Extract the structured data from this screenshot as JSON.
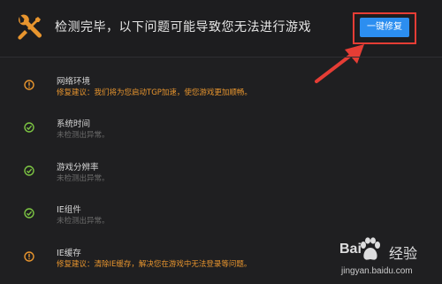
{
  "header": {
    "title": "检测完毕，以下问题可能导致您无法进行游戏",
    "fix_button_label": "一键修复"
  },
  "items": [
    {
      "name": "网络环境",
      "detail": "修复建议：我们将为您启动TGP加速，使您游戏更加顺畅。",
      "status": "warning"
    },
    {
      "name": "系统时间",
      "detail": "未检测出异常。",
      "status": "ok"
    },
    {
      "name": "游戏分辨率",
      "detail": "未检测出异常。",
      "status": "ok"
    },
    {
      "name": "IE组件",
      "detail": "未检测出异常。",
      "status": "ok"
    },
    {
      "name": "IE缓存",
      "detail": "修复建议：清除IE缓存，解决您在游戏中无法登录等问题。",
      "status": "warning"
    }
  ],
  "watermark": {
    "brand_text_1": "Bai",
    "brand_text_2": "经验",
    "url": "jingyan.baidu.com"
  },
  "colors": {
    "background": "#1f1f21",
    "accent_blue": "#2c8ef0",
    "warning_orange": "#e8952e",
    "ok_green": "#7cc443",
    "highlight_red": "#e53d35"
  }
}
